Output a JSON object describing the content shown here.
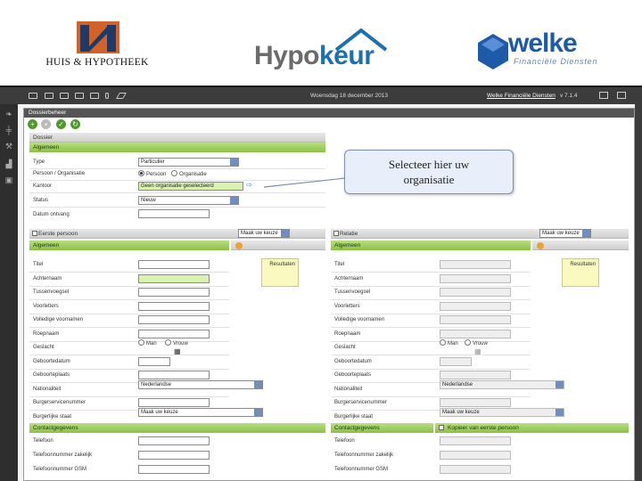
{
  "logos": {
    "huis": "HUIS & HYPOTHEEK",
    "hypokeur_a": "Hypo",
    "hypokeur_b": "keur",
    "welke": "welke",
    "welke_sub": "Financiële Diensten"
  },
  "topbar": {
    "date": "Woensdag 18 december 2013",
    "firm": "Welke Financiële Diensten",
    "version": "v 7.1.4"
  },
  "panel": {
    "title": "Dossierbeheer"
  },
  "dossier": {
    "header": "Dossier",
    "section": "Algemeen",
    "fields": {
      "type_label": "Type",
      "type_value": "Particulier",
      "persoon_label": "Persoon / Organisatie",
      "persoon_opt1": "Persoon",
      "persoon_opt2": "Organisatie",
      "kantoor_label": "Kantoor",
      "kantoor_value": "Geen organisatie geselecteerd",
      "status_label": "Status",
      "status_value": "Nieuw",
      "datum_label": "Datum ontvang"
    }
  },
  "callout": {
    "line1": "Selecteer hier uw",
    "line2": "organisatie"
  },
  "left": {
    "header": "Eerste persoon",
    "select": "Maak uw keuze",
    "section": "Algemeen",
    "result": "Resultaten",
    "rows": [
      "Titel",
      "Achternaam",
      "Tussenvoegsel",
      "Voorletters",
      "Volledige voornamen",
      "Roepnaam",
      "Geslacht",
      "Geboortedatum",
      "Geboorteplaats",
      "Nationaliteit",
      "Burgerservicenummer",
      "Burgerlijke staat"
    ],
    "gender_m": "Man",
    "gender_v": "Vrouw",
    "nationality": "Nederlandse",
    "civil": "Maak uw keuze",
    "contact_section": "Contactgegevens",
    "contact_rows": [
      "Telefoon",
      "Telefoonnummer zakelijk",
      "Telefoonnummer GSM"
    ]
  },
  "right": {
    "header": "Relatie",
    "select": "Maak uw keuze",
    "section": "Algemeen",
    "result": "Resultaten",
    "rows": [
      "Titel",
      "Achternaam",
      "Tussenvoegsel",
      "Voorletters",
      "Volledige voornamen",
      "Roepnaam",
      "Geslacht",
      "Geboortedatum",
      "Geboorteplaats",
      "Nationaliteit",
      "Burgerservicenummer",
      "Burgerlijke staat"
    ],
    "gender_m": "Man",
    "gender_v": "Vrouw",
    "nationality": "Nederlandse",
    "civil": "Maak uw keuze",
    "contact_section": "Contactgegevens",
    "copy_header": "Kopieer van eerste persoon",
    "contact_rows": [
      "Telefoon",
      "Telefoonnummer zakelijk",
      "Telefoonnummer GSM"
    ]
  },
  "colors": {
    "accent_green": "#8cc046",
    "dark_bar": "#3c3c3c",
    "callout_bg": "#e8eefa"
  }
}
